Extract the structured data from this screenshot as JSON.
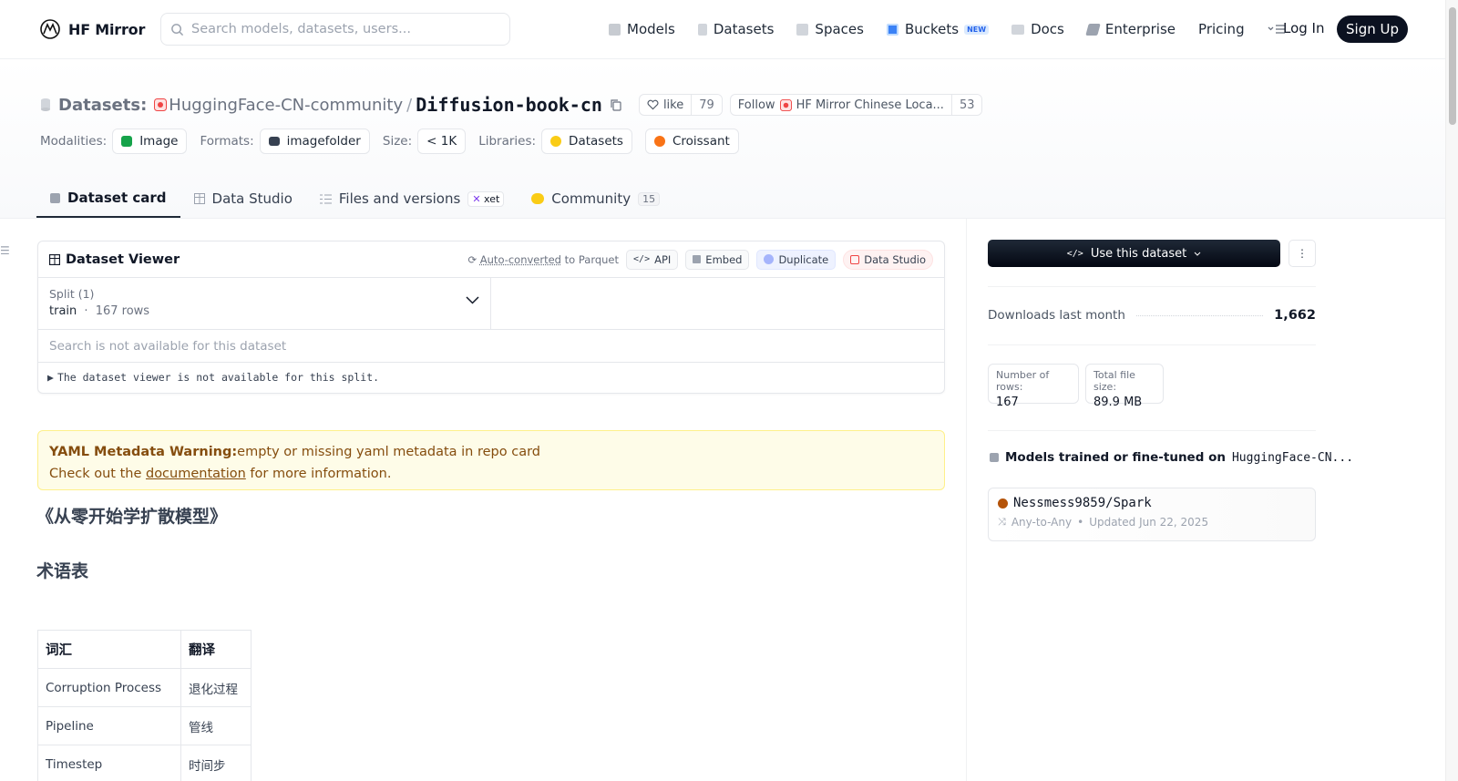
{
  "brand": {
    "name": "HF Mirror"
  },
  "search": {
    "placeholder": "Search models, datasets, users..."
  },
  "nav": {
    "items": [
      {
        "label": "Models",
        "icon": "cube-icon",
        "color": "#9ca3af"
      },
      {
        "label": "Datasets",
        "icon": "database-icon",
        "color": "#9ca3af"
      },
      {
        "label": "Spaces",
        "icon": "grid-icon",
        "color": "#9ca3af"
      },
      {
        "label": "Buckets",
        "icon": "bucket-icon",
        "color": "#2563eb"
      },
      {
        "label": "Docs",
        "icon": "book-icon",
        "color": "#9ca3af"
      },
      {
        "label": "Enterprise",
        "icon": "enterprise-icon",
        "color": "#6b7280"
      },
      {
        "label": "Pricing"
      }
    ],
    "new_badge": "NEW",
    "login": "Log In",
    "signup": "Sign Up"
  },
  "repo": {
    "type_label": "Datasets:",
    "org": "HuggingFace-CN-community",
    "separator": "/",
    "name": "Diffusion-book-cn",
    "like_label": "like",
    "like_count": "79",
    "follow_label": "Follow",
    "follow_org": "HF Mirror Chinese Loca...",
    "follow_count": "53"
  },
  "meta": {
    "modalities_label": "Modalities:",
    "modality": "Image",
    "formats_label": "Formats:",
    "format": "imagefolder",
    "size_label": "Size:",
    "size": "< 1K",
    "libraries_label": "Libraries:",
    "libraries": [
      "Datasets",
      "Croissant"
    ]
  },
  "tabs": [
    {
      "label": "Dataset card",
      "active": true
    },
    {
      "label": "Data Studio"
    },
    {
      "label": "Files and versions",
      "badge": "xet"
    },
    {
      "label": "Community",
      "badge": "15"
    }
  ],
  "viewer": {
    "title": "Dataset Viewer",
    "auto_link": "Auto-converted",
    "auto_rest": " to Parquet",
    "actions": [
      "API",
      "Embed",
      "Duplicate",
      "Data Studio"
    ],
    "split_label": "Split (1)",
    "split_name": "train",
    "split_sep": "·",
    "split_rows": "167 rows",
    "search_na": "Search is not available for this dataset",
    "na_text": "The dataset viewer is not available for this split."
  },
  "warning": {
    "bold": "YAML Metadata Warning:",
    "text": "empty or missing yaml metadata in repo card",
    "line2_pre": "Check out the ",
    "link": "documentation",
    "line2_post": " for more information."
  },
  "content": {
    "h1": "《从零开始学扩散模型》",
    "h2": "术语表",
    "table": {
      "headers": [
        "词汇",
        "翻译"
      ],
      "rows": [
        [
          "Corruption Process",
          "退化过程"
        ],
        [
          "Pipeline",
          "管线"
        ],
        [
          "Timestep",
          "时间步"
        ]
      ]
    }
  },
  "sidebar": {
    "use_button": "Use this dataset",
    "downloads_label": "Downloads last month",
    "downloads": "1,662",
    "rows_label": "Number of rows:",
    "rows": "167",
    "size_label": "Total file size:",
    "size": "89.9 MB",
    "models_head": "Models trained or fine-tuned on",
    "models_repo": "HuggingFace-CN...",
    "model": {
      "name": "Nessmess9859/Spark",
      "task": "Any-to-Any",
      "dot": "•",
      "updated": "Updated Jun 22, 2025"
    }
  }
}
